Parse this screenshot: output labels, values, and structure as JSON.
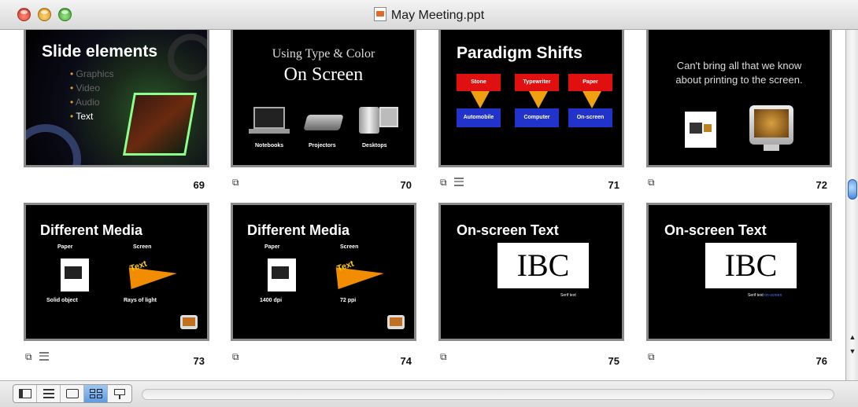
{
  "window": {
    "title": "May Meeting.ppt"
  },
  "slides": [
    {
      "number": "69",
      "title": "Slide elements",
      "bullets": [
        "Graphics",
        "Video",
        "Audio",
        "Text"
      ],
      "has_transition": false,
      "has_notes": false
    },
    {
      "number": "70",
      "title_line1": "Using Type & Color",
      "title_line2": "On Screen",
      "labels": [
        "Notebooks",
        "Projectors",
        "Desktops"
      ],
      "has_transition": true,
      "has_notes": false
    },
    {
      "number": "71",
      "title": "Paradigm Shifts",
      "tops": [
        "Stone",
        "Typewriter",
        "Paper"
      ],
      "bottoms": [
        "Automobile",
        "Computer",
        "On-screen"
      ],
      "has_transition": true,
      "has_notes": true
    },
    {
      "number": "72",
      "text_line1": "Can't bring all that we know",
      "text_line2": "about printing to the screen.",
      "has_transition": true,
      "has_notes": false
    },
    {
      "number": "73",
      "title": "Different Media",
      "col1": "Paper",
      "col2": "Screen",
      "badge": "Text",
      "cap1": "Solid object",
      "cap2": "Rays of light",
      "has_transition": true,
      "has_notes": true
    },
    {
      "number": "74",
      "title": "Different Media",
      "col1": "Paper",
      "col2": "Screen",
      "badge": "Text",
      "cap1": "1400 dpi",
      "cap2": "72 ppi",
      "has_transition": true,
      "has_notes": false
    },
    {
      "number": "75",
      "title": "On-screen Text",
      "box": "IBC",
      "caption": "Serif text",
      "has_transition": true,
      "has_notes": false
    },
    {
      "number": "76",
      "title": "On-screen Text",
      "box": "IBC",
      "caption": "Serif text",
      "caption_accent": "on-screen",
      "has_transition": true,
      "has_notes": false
    }
  ],
  "colors": {
    "accent_blue": "#3b82d6",
    "slide_bg": "#000000",
    "para_red": "#e01010",
    "para_blue": "#2233cc",
    "para_orange": "#f0a010",
    "badge_orange": "#f28c00"
  },
  "toolbar": {
    "views": [
      "normal-view-icon",
      "outline-view-icon",
      "slide-view-icon",
      "slide-sorter-view-icon",
      "slide-show-icon"
    ],
    "active_view": "slide-sorter-view-icon"
  }
}
